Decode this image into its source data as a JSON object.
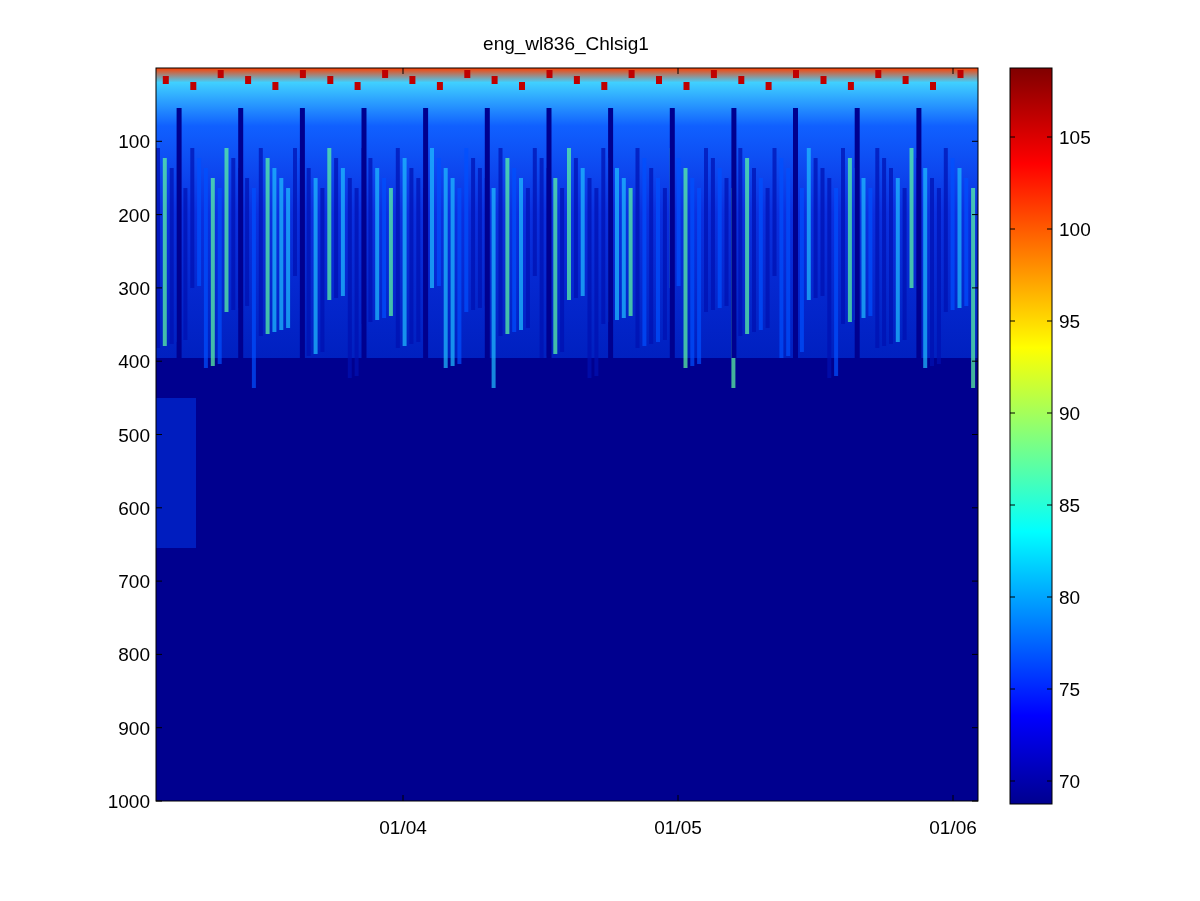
{
  "title": "eng_wl836_Chlsig1",
  "plot": {
    "y_ticks": [
      "100",
      "200",
      "300",
      "400",
      "500",
      "600",
      "700",
      "800",
      "900",
      "1000"
    ],
    "x_ticks": [
      "01/04",
      "01/05",
      "01/06"
    ]
  },
  "colorbar": {
    "ticks": [
      "105",
      "100",
      "95",
      "90",
      "85",
      "80",
      "75",
      "70"
    ]
  }
}
